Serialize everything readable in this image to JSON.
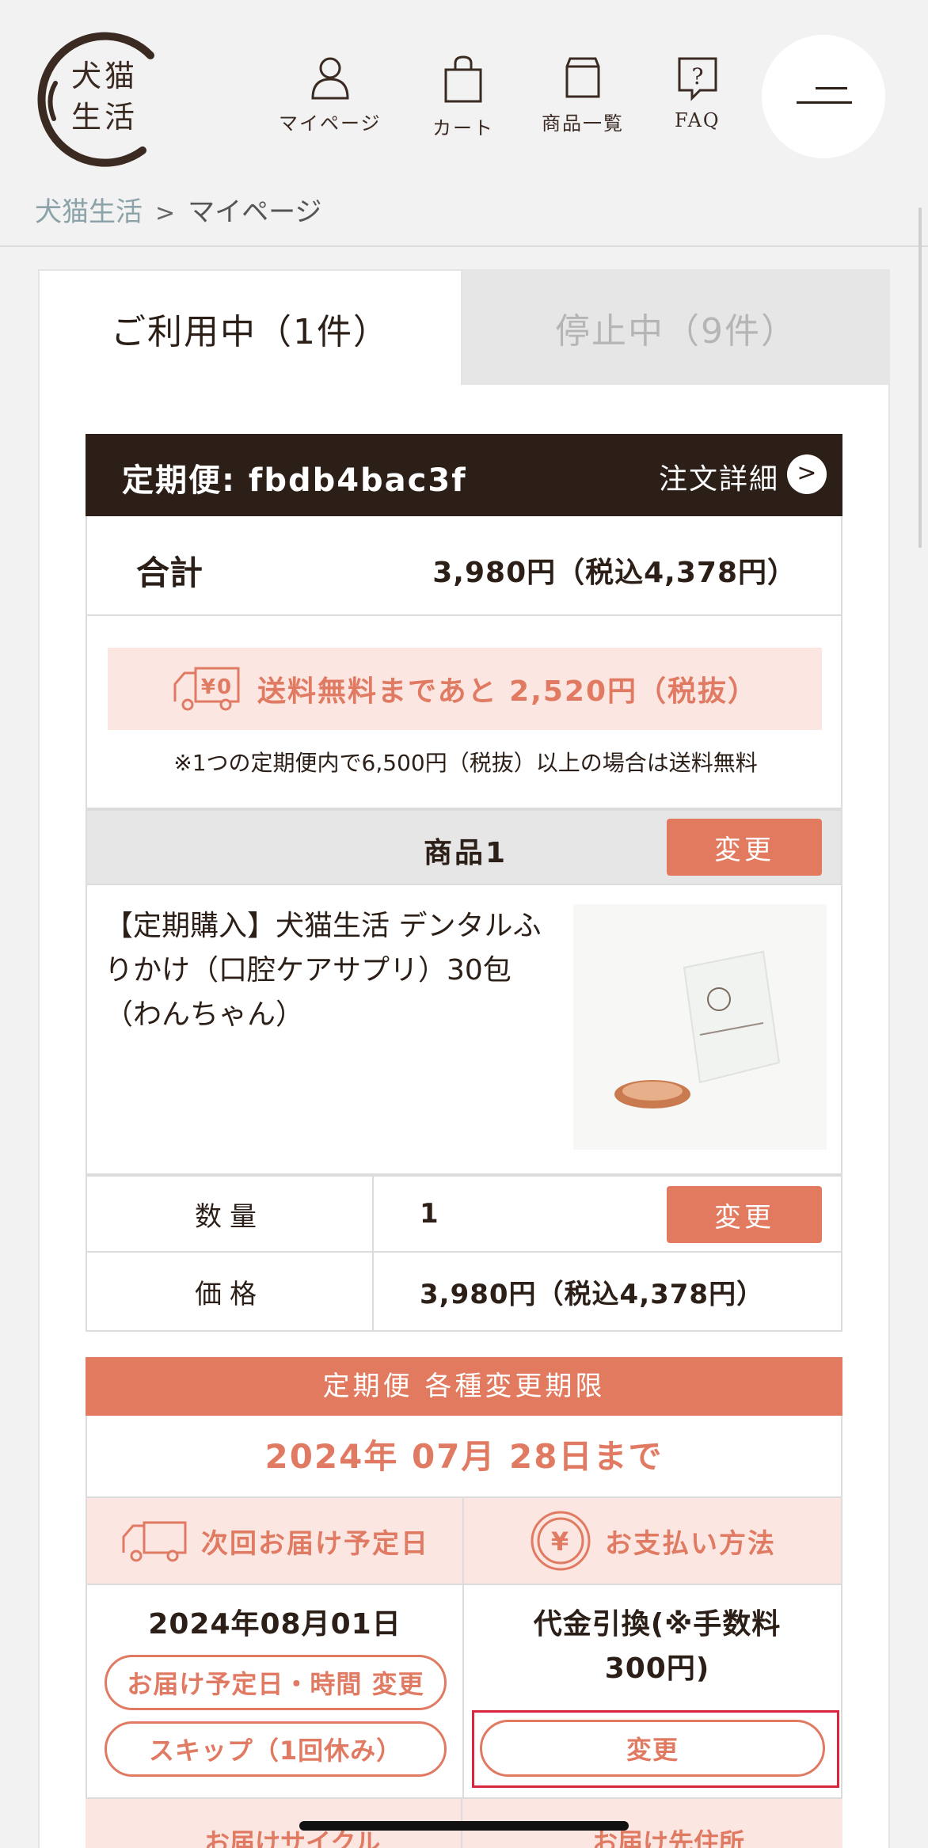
{
  "header": {
    "logo_text_line1": "犬猫",
    "logo_text_line2": "生活",
    "nav": [
      {
        "label": "マイページ",
        "icon": "user-icon"
      },
      {
        "label": "カート",
        "icon": "bag-icon"
      },
      {
        "label": "商品一覧",
        "icon": "box-icon"
      },
      {
        "label": "FAQ",
        "icon": "question-icon"
      }
    ],
    "menu_icon": "hamburger-icon"
  },
  "breadcrumb": {
    "home": "犬猫生活",
    "separator": ">",
    "current": "マイページ"
  },
  "tabs": [
    {
      "label": "ご利用中（1件）",
      "active": true
    },
    {
      "label": "停止中（9件）",
      "active": false
    }
  ],
  "order": {
    "id_label": "定期便: fbdb4bac3f",
    "detail_label": "注文詳細",
    "detail_arrow": ">",
    "total_label": "合計",
    "total_value": "3,980円（税込4,378円）",
    "shipping_banner": "送料無料まであと 2,520円（税抜）",
    "shipping_icon_text": "¥0",
    "shipping_note": "※1つの定期便内で6,500円（税抜）以上の場合は送料無料",
    "product_header": "商品1",
    "change_label": "変更",
    "product_name": "【定期購入】犬猫生活 デンタルふりかけ（口腔ケアサプリ）30包（わんちゃん）",
    "quantity_label": "数量",
    "quantity_value": "1",
    "price_label": "価格",
    "price_value": "3,980円（税込4,378円）"
  },
  "deadline": {
    "title": "定期便 各種変更期限",
    "date": "2024年 07月 28日まで"
  },
  "delivery": {
    "title": "次回お届け予定日",
    "date": "2024年08月01日",
    "change_datetime_label": "お届け予定日・時間 変更",
    "skip_label": "スキップ（1回休み）"
  },
  "payment": {
    "title": "お支払い方法",
    "method": "代金引換(※手数料300円)",
    "change_label": "変更"
  },
  "bottom": {
    "cycle_label": "お届けサイクル",
    "address_label": "お届け先住所"
  },
  "colors": {
    "accent": "#e27a5f",
    "accent_light": "#fbe6e1",
    "dark": "#2b1f18",
    "highlight": "#d7263d"
  }
}
